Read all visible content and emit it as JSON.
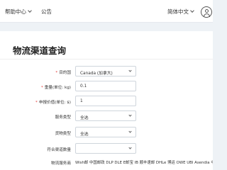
{
  "topbar": {
    "help_label": "帮助中心",
    "notice_label": "公告",
    "language_label": "简体中文"
  },
  "page": {
    "title": "物流渠道查询"
  },
  "form": {
    "destination": {
      "label": "目的国",
      "value": "Canada (加拿大)",
      "required": true
    },
    "weight": {
      "label": "重量(单位: kg)",
      "value": "0.1",
      "required": true
    },
    "declared_value": {
      "label": "申报价值(单位: $)",
      "value": "1",
      "required": true
    },
    "service_type": {
      "label": "服务类型",
      "value": "全选"
    },
    "goods_type": {
      "label": "货物类型",
      "value": "全选"
    },
    "matching_product": {
      "label": "符合渠道数量",
      "value": ""
    },
    "logistics_service": {
      "label": "物流服务商",
      "value": "Wish邮 中国邮政 DLP DLE E邮宝 IB 顺丰速邮 DHLe 博运 OWE UBI Asendia 中..."
    }
  }
}
